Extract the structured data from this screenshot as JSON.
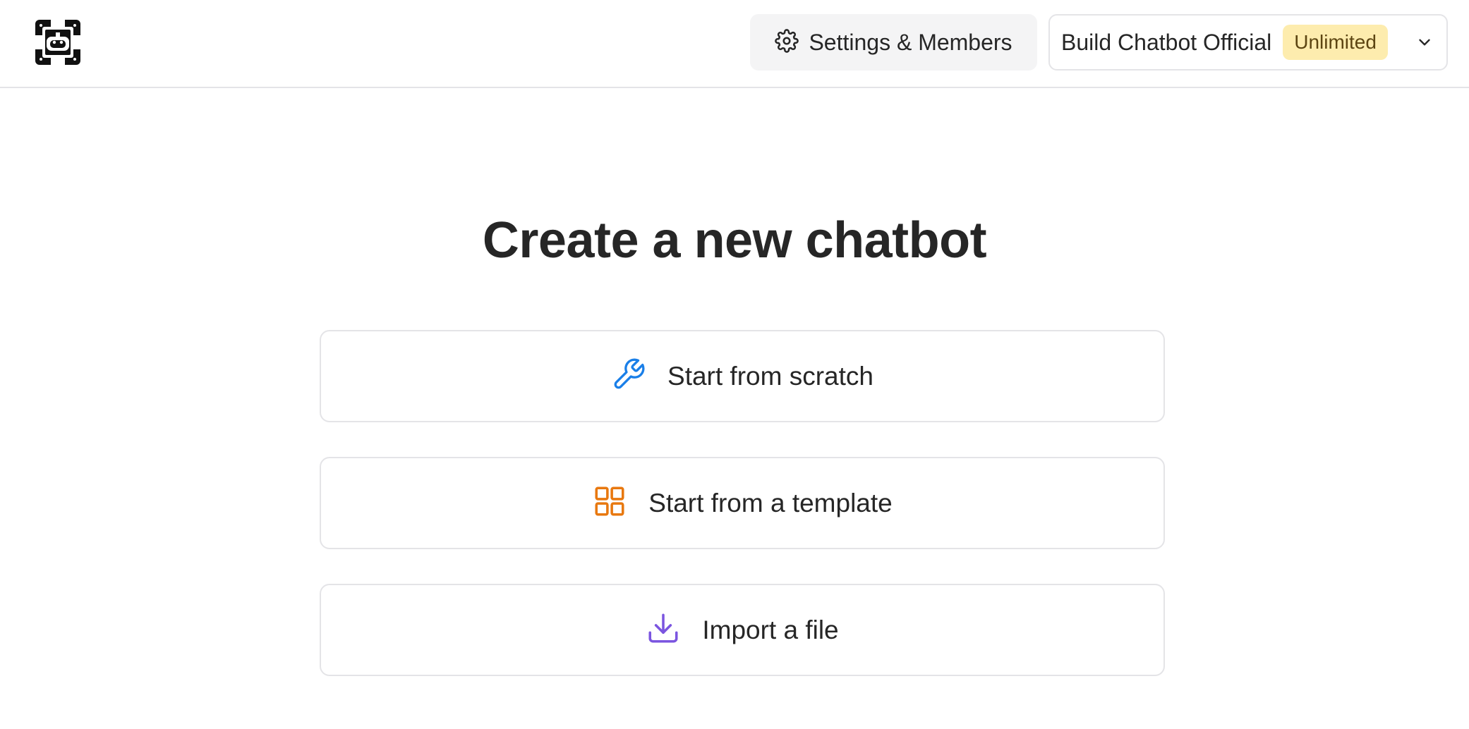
{
  "header": {
    "logo_icon": "robot-logo-icon",
    "settings": {
      "label": "Settings & Members",
      "icon": "gear-icon"
    },
    "workspace": {
      "name": "Build Chatbot Official",
      "plan_badge": "Unlimited",
      "badge_color": "#fdecae",
      "dropdown_icon": "chevron-down-icon"
    }
  },
  "main": {
    "title": "Create a new chatbot",
    "options": [
      {
        "label": "Start from scratch",
        "icon": "wrench-icon",
        "icon_color": "#1a7fe8"
      },
      {
        "label": "Start from a template",
        "icon": "grid-icon",
        "icon_color": "#e8780f"
      },
      {
        "label": "Import a file",
        "icon": "download-icon",
        "icon_color": "#7b55e0"
      }
    ]
  }
}
